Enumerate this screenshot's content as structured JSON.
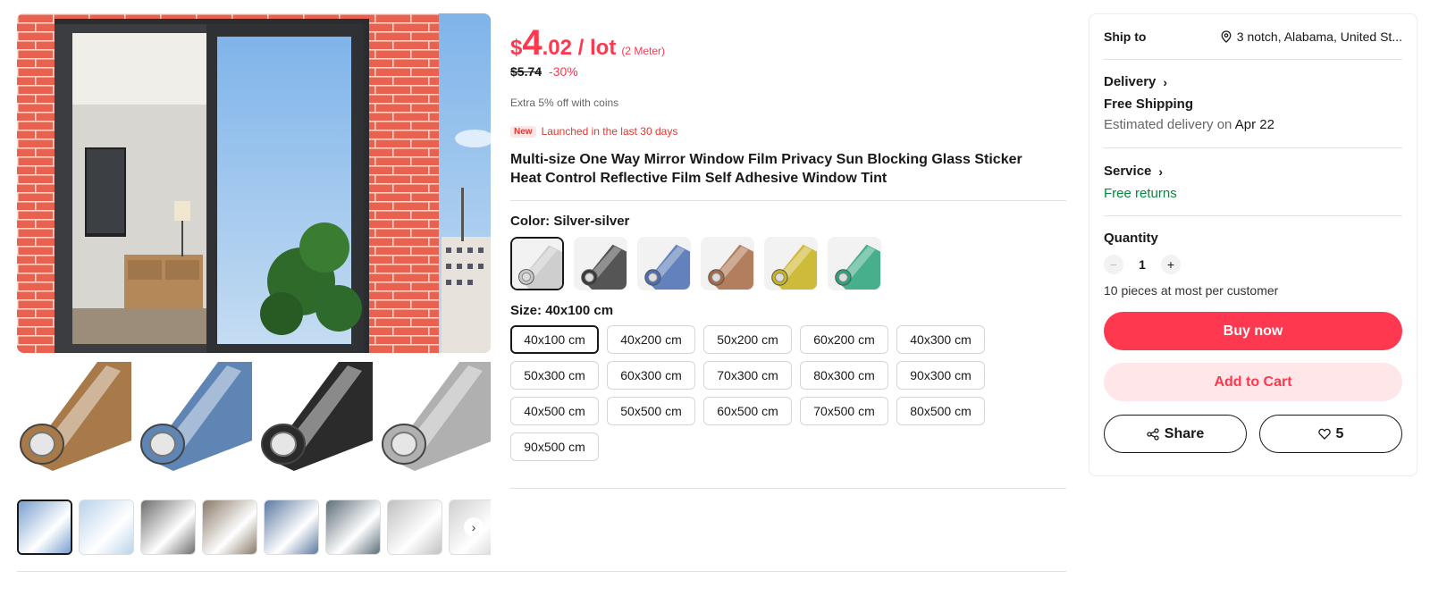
{
  "price": {
    "currency": "$",
    "integer": "4",
    "decimal": ".02",
    "unit": " / lot",
    "unit_note": "(2 Meter)",
    "original": "$5.74",
    "discount": "-30%",
    "coins_note": "Extra 5% off with coins"
  },
  "badge": {
    "label": "New",
    "text": "Launched in the last 30 days"
  },
  "product": {
    "title": "Multi-size One Way Mirror Window Film Privacy Sun Blocking Glass Sticker Heat Control Reflective Film Self Adhesive Window Tint"
  },
  "color": {
    "label": "Color: ",
    "selected": "Silver-silver",
    "options": [
      {
        "name": "Silver-silver",
        "hex": "#c8c8c8"
      },
      {
        "name": "Black-silver",
        "hex": "#3a3a3a"
      },
      {
        "name": "Blue-silver",
        "hex": "#4a6db3"
      },
      {
        "name": "Brown-silver",
        "hex": "#a86a43"
      },
      {
        "name": "Gold-silver",
        "hex": "#c9b21a"
      },
      {
        "name": "Green-silver",
        "hex": "#2aa37a"
      }
    ]
  },
  "size": {
    "label": "Size: ",
    "selected": "40x100 cm",
    "options": [
      "40x100 cm",
      "40x200 cm",
      "50x200 cm",
      "60x200 cm",
      "40x300 cm",
      "50x300 cm",
      "60x300 cm",
      "70x300 cm",
      "80x300 cm",
      "90x300 cm",
      "40x500 cm",
      "50x500 cm",
      "60x500 cm",
      "70x500 cm",
      "80x500 cm",
      "90x500 cm"
    ]
  },
  "gallery": {
    "thumb_next_icon": "chevron-right-icon",
    "roll_colors": [
      "#a87a4a",
      "#5f85b4",
      "#2b2b2b",
      "#b0b0b0"
    ],
    "thumbs": [
      {
        "name": "thumb-1",
        "color": "#7aa0cf"
      },
      {
        "name": "thumb-2",
        "color": "#b9d3ea"
      },
      {
        "name": "thumb-3",
        "color": "#6d6d6d"
      },
      {
        "name": "thumb-4",
        "color": "#8a7a6a"
      },
      {
        "name": "thumb-5",
        "color": "#5b7aa2"
      },
      {
        "name": "thumb-6",
        "color": "#5d6e78"
      },
      {
        "name": "thumb-7",
        "color": "#c0c0c0"
      },
      {
        "name": "thumb-8",
        "color": "#d0d0d0"
      }
    ]
  },
  "panel": {
    "ship_to_label": "Ship to",
    "ship_to_address": "3 notch, Alabama, United St...",
    "delivery_label": "Delivery",
    "shipping": "Free Shipping",
    "estimated_prefix": "Estimated delivery on ",
    "estimated_date": "Apr 22",
    "service_label": "Service",
    "returns": "Free returns",
    "quantity_label": "Quantity",
    "quantity": "1",
    "minus": "−",
    "plus": "+",
    "limit": "10 pieces at most per customer",
    "buy_now": "Buy now",
    "add_to_cart": "Add to Cart",
    "share": "Share",
    "wishlist_count": "5"
  },
  "colors": {
    "accent": "#fd384f",
    "accent_light": "#ffe7e9",
    "green": "#008a3e",
    "text": "#191919"
  }
}
